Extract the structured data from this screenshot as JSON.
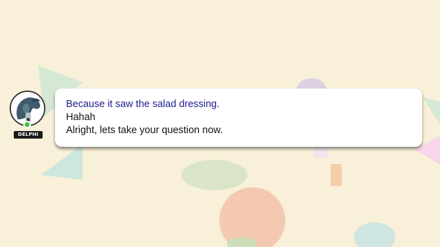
{
  "speaker": {
    "name": "DELPHI",
    "avatar_icon": "dolphin-avatar-icon",
    "status": "online",
    "status_color": "#2ecc2e"
  },
  "message": {
    "lines": [
      {
        "text": "Because it saw the salad dressing.",
        "color": "#1c1c8c"
      },
      {
        "text": "Hahah",
        "color": "#111111"
      },
      {
        "text": "Alright, lets take your question now.",
        "color": "#111111"
      }
    ]
  },
  "colors": {
    "background": "#f8f0d8",
    "bubble": "#ffffff"
  }
}
